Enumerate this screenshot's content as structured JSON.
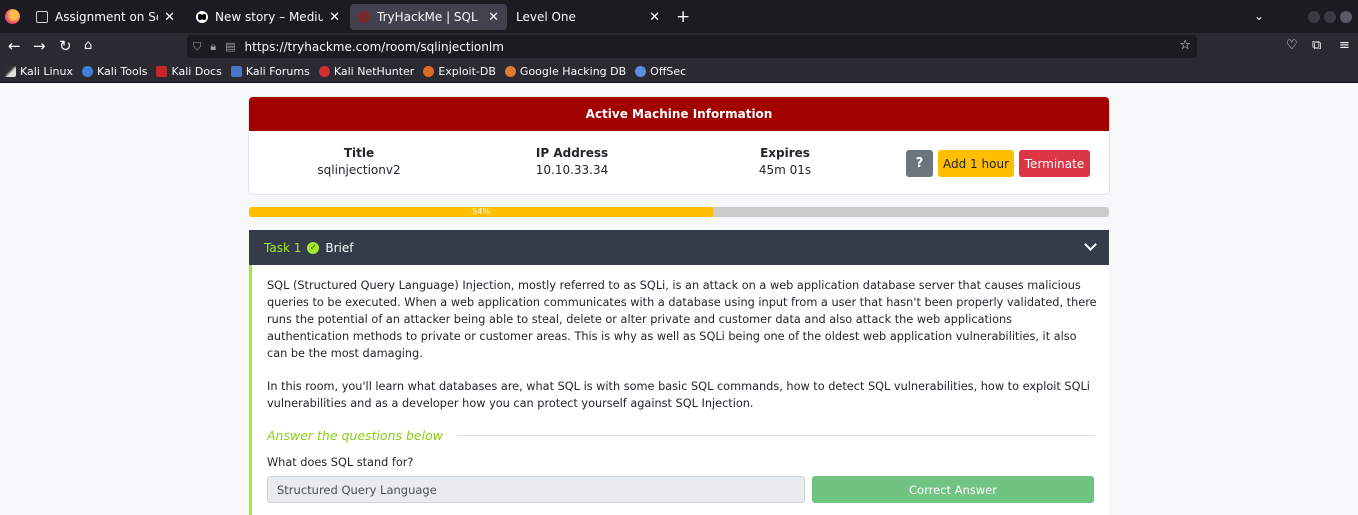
{
  "browser": {
    "tabs": [
      {
        "title": "Assignment on Sql injecti",
        "active": false
      },
      {
        "title": "New story – Medium",
        "active": false
      },
      {
        "title": "TryHackMe | SQL Injection",
        "active": true
      },
      {
        "title": "Level One",
        "active": false
      }
    ],
    "url": "https://tryhackme.com/room/sqlinjectionlm",
    "bookmarks": [
      "Kali Linux",
      "Kali Tools",
      "Kali Docs",
      "Kali Forums",
      "Kali NetHunter",
      "Exploit-DB",
      "Google Hacking DB",
      "OffSec"
    ]
  },
  "machine": {
    "header": "Active Machine Information",
    "title_label": "Title",
    "title_value": "sqlinjectionv2",
    "ip_label": "IP Address",
    "ip_value": "10.10.33.34",
    "expires_label": "Expires",
    "expires_value": "45m 01s",
    "help_label": "?",
    "add_label": "Add 1 hour",
    "terminate_label": "Terminate"
  },
  "progress": {
    "label": "54%",
    "value": 0.54
  },
  "task": {
    "number": "Task 1",
    "title": "Brief",
    "paragraph1": "SQL (Structured Query Language) Injection, mostly referred to as SQLi, is an attack on a web application database server that causes malicious queries to be executed. When a web application communicates with a database using input from a user that hasn't been properly validated, there runs the potential of an attacker being able to steal, delete or alter private and customer data and also attack the web applications authentication methods to private or customer areas. This is why as well as SQLi being one of the oldest web application vulnerabilities, it also can be the most damaging.",
    "paragraph2": "In this room, you'll learn what databases are, what SQL is with some basic SQL commands, how to detect SQL vulnerabilities, how to exploit SQLi vulnerabilities and as a developer how you can protect yourself against SQL Injection.",
    "answer_heading": "Answer the questions below",
    "question": "What does SQL stand for?",
    "answer_value": "Structured Query Language",
    "answer_button": "Correct Answer"
  },
  "colors": {
    "machine_header": "#a30000",
    "progress": "#ffbe00",
    "task_accent": "#a3ea2a",
    "correct": "#71c382"
  }
}
